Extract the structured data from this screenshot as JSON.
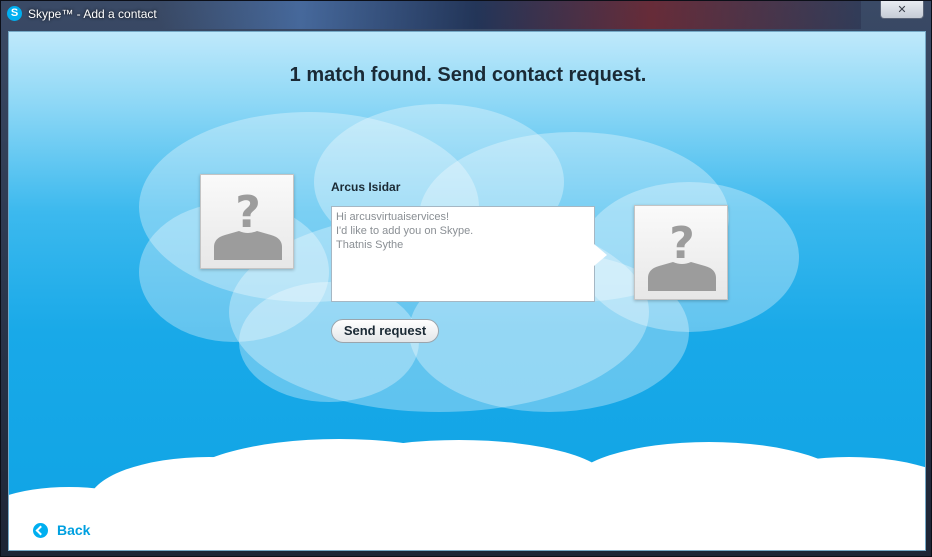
{
  "window": {
    "title": "Skype™ - Add a contact",
    "logo_letter": "S",
    "close_glyph": "✕"
  },
  "main": {
    "headline": "1 match found. Send contact request.",
    "contact_name": "Arcus Isidar",
    "message": "Hi arcusvirtuaiservices!\nI'd like to add you on Skype.\nThatnis Sythe",
    "send_label": "Send request",
    "back_label": "Back"
  },
  "icons": [
    "skype-logo-icon",
    "close-icon",
    "avatar-placeholder-icon",
    "back-arrow-icon"
  ],
  "colors": {
    "accent": "#00aff0",
    "sky_top": "#bfe9fb",
    "sky_bottom": "#0ea3e5",
    "cloud": "#ffffff",
    "headline": "#1a2a36"
  }
}
